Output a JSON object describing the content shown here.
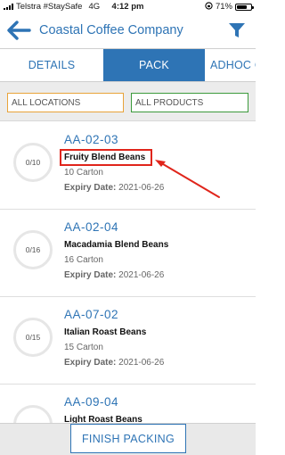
{
  "status_bar": {
    "carrier": "Telstra #StaySafe",
    "network": "4G",
    "time": "4:12 pm",
    "battery": "71%",
    "battery_level": 0.71
  },
  "header": {
    "title": "Coastal Coffee Company",
    "accent_color": "#2e74b5"
  },
  "tabs": [
    {
      "label": "DETAILS",
      "active": false
    },
    {
      "label": "PACK",
      "active": true
    },
    {
      "label": "ADHOC C",
      "active": false
    }
  ],
  "filters": {
    "locations": "ALL LOCATIONS",
    "products": "ALL PRODUCTS"
  },
  "items": [
    {
      "code": "AA-02-03",
      "name": "Fruity Blend Beans",
      "qty": "10 Carton",
      "expiry_label": "Expiry Date:",
      "expiry": "2021-06-26",
      "progress": "0/10"
    },
    {
      "code": "AA-02-04",
      "name": "Macadamia Blend Beans",
      "qty": "16 Carton",
      "expiry_label": "Expiry Date:",
      "expiry": "2021-06-26",
      "progress": "0/16"
    },
    {
      "code": "AA-07-02",
      "name": "Italian Roast Beans",
      "qty": "15 Carton",
      "expiry_label": "Expiry Date:",
      "expiry": "2021-06-26",
      "progress": "0/15"
    },
    {
      "code": "AA-09-04",
      "name": "Light Roast Beans",
      "qty": "",
      "expiry_label": "",
      "expiry": "",
      "progress": ""
    }
  ],
  "footer": {
    "finish_label": "FINISH PACKING"
  },
  "annotation_color": "#e0251b"
}
